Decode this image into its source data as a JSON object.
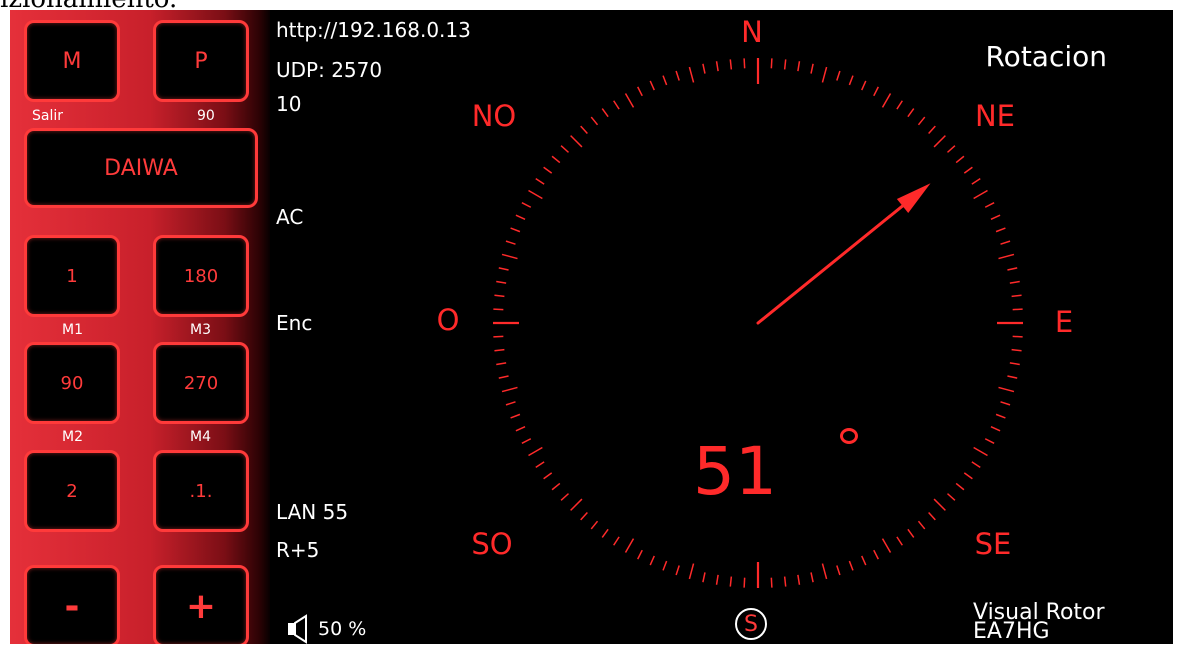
{
  "caption": "izionamiento.",
  "colors": {
    "accent": "#ff2a2a",
    "panel": "#d7262f",
    "background": "#000000"
  },
  "panel": {
    "mode_button": "M",
    "p_button": "P",
    "exit_label": "Salir",
    "p_value": "90",
    "brand_button": "DAIWA",
    "memories": [
      {
        "value": "1",
        "label": "M1"
      },
      {
        "value": "180",
        "label": "M3"
      },
      {
        "value": "90",
        "label": "M2"
      },
      {
        "value": "270",
        "label": "M4"
      }
    ],
    "btn_2": "2",
    "btn_dot": ".1.",
    "minus": "-",
    "plus": "+"
  },
  "info": {
    "url": "http://192.168.0.13",
    "udp": "UDP: 2570",
    "value": "10",
    "power": "AC",
    "state": "Enc",
    "lan": "LAN 55",
    "offset": "R+5",
    "volume": "50 %"
  },
  "compass": {
    "title": "Rotacion",
    "heading": 51,
    "heading_text": "51",
    "directions": {
      "n": "N",
      "ne": "NE",
      "e": "E",
      "se": "SE",
      "s": "S",
      "so": "SO",
      "o": "O",
      "no": "NO"
    }
  },
  "footer": {
    "credits_line1": "Visual Rotor",
    "credits_line2": "EA7HG",
    "icons": [
      "speaker-icon",
      "s-button-icon"
    ]
  }
}
